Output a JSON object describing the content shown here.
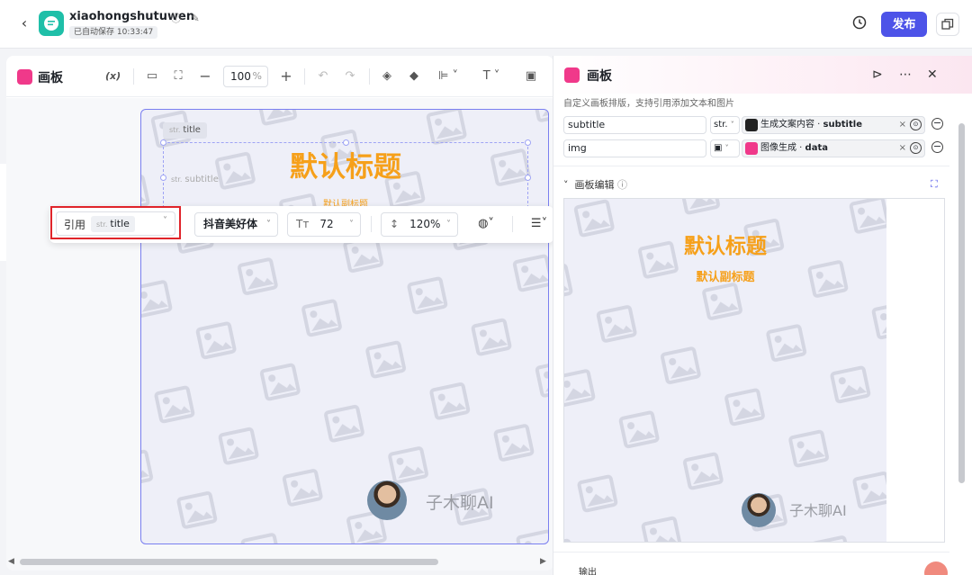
{
  "header": {
    "app_name": "xiaohongshutuwen",
    "autosave": "已自动保存 10:33:47",
    "publish_label": "发布"
  },
  "canvas_panel": {
    "title": "画板",
    "var_label": "(x)",
    "zoom_value": "100",
    "zoom_unit": "%"
  },
  "artboard": {
    "title_tag_prefix": "str.",
    "title_tag": "title",
    "subtitle_tag_prefix": "str.",
    "subtitle_tag": "subtitle",
    "title_text": "默认标题",
    "subtitle_text": "默认副标题",
    "avatar_name": "子木聊AI"
  },
  "float_toolbar": {
    "ref_label": "引用",
    "ref_chip_prefix": "str.",
    "ref_chip": "title",
    "font": "抖音美好体",
    "font_size_icon": "Tт",
    "font_size": "72",
    "line_height": "120%"
  },
  "right_panel": {
    "title": "画板",
    "description": "自定义画板排版，支持引用添加文本和图片",
    "params": [
      {
        "name": "subtitle",
        "type": "str.",
        "ref_source": "生成文案内容",
        "ref_field": "subtitle"
      },
      {
        "name": "img",
        "type": "",
        "ref_source": "图像生成",
        "ref_field": "data"
      }
    ],
    "section_title": "画板编辑",
    "preview_title": "默认标题",
    "preview_subtitle": "默认副标题",
    "preview_avatar_name": "子木聊AI",
    "output_label": "输出"
  },
  "colors": {
    "accent": "#4d53e8",
    "title_orange": "#f6a01a",
    "highlight_red": "#e0242a",
    "app_logo": "#1fbfa8",
    "board_logo": "#f0398a"
  }
}
